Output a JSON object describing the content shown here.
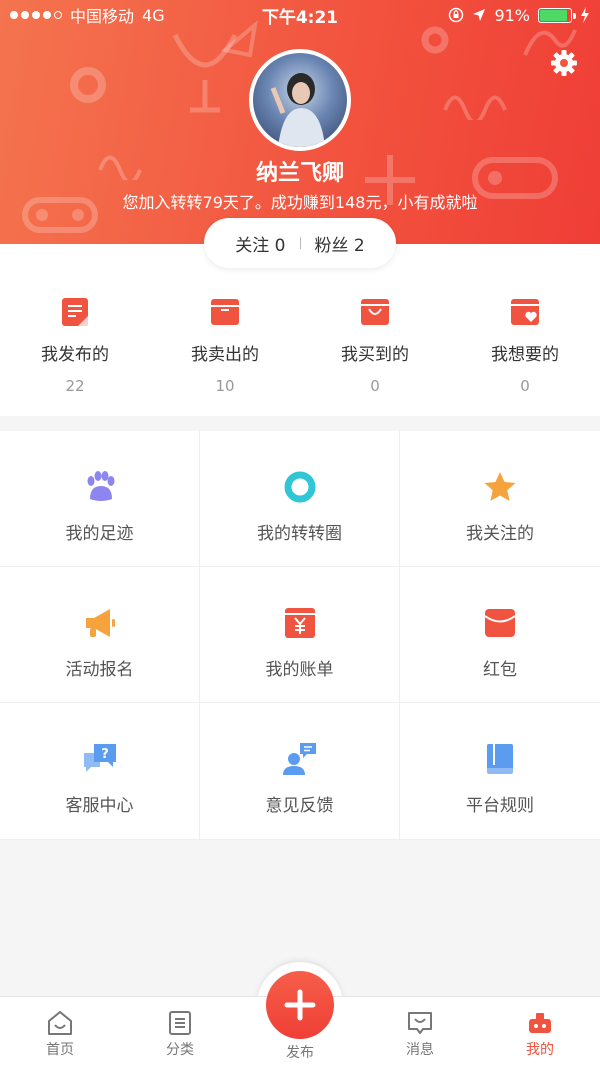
{
  "status_bar": {
    "carrier": "中国移动",
    "network": "4G",
    "time": "下午4:21",
    "battery": "91%",
    "battery_level": 0.91
  },
  "profile": {
    "name": "纳兰飞卿",
    "tagline": "您加入转转79天了。成功赚到148元，小有成就啦",
    "follow_label": "关注 0",
    "fans_label": "粉丝 2"
  },
  "stats": [
    {
      "label": "我发布的",
      "value": "22",
      "icon": "published-icon",
      "color": "#f0533f"
    },
    {
      "label": "我卖出的",
      "value": "10",
      "icon": "sold-icon",
      "color": "#f0533f"
    },
    {
      "label": "我买到的",
      "value": "0",
      "icon": "bought-icon",
      "color": "#f0533f"
    },
    {
      "label": "我想要的",
      "value": "0",
      "icon": "wanted-icon",
      "color": "#f0533f"
    }
  ],
  "menu": [
    {
      "label": "我的足迹",
      "icon": "paw-icon",
      "color": "#8e86f0"
    },
    {
      "label": "我的转转圈",
      "icon": "ring-icon",
      "color": "#30c6d6"
    },
    {
      "label": "我关注的",
      "icon": "star-icon",
      "color": "#f7a33d"
    },
    {
      "label": "活动报名",
      "icon": "megaphone-icon",
      "color": "#f7a33d"
    },
    {
      "label": "我的账单",
      "icon": "bill-icon",
      "color": "#f0533f"
    },
    {
      "label": "红包",
      "icon": "red-envelope-icon",
      "color": "#f0533f"
    },
    {
      "label": "客服中心",
      "icon": "help-chat-icon",
      "color": "#5b9cf0"
    },
    {
      "label": "意见反馈",
      "icon": "feedback-icon",
      "color": "#5b9cf0"
    },
    {
      "label": "平台规则",
      "icon": "rules-book-icon",
      "color": "#5b9cf0"
    }
  ],
  "tabbar": {
    "home": "首页",
    "category": "分类",
    "publish": "发布",
    "messages": "消息",
    "mine": "我的",
    "active_color": "#f0533f"
  }
}
